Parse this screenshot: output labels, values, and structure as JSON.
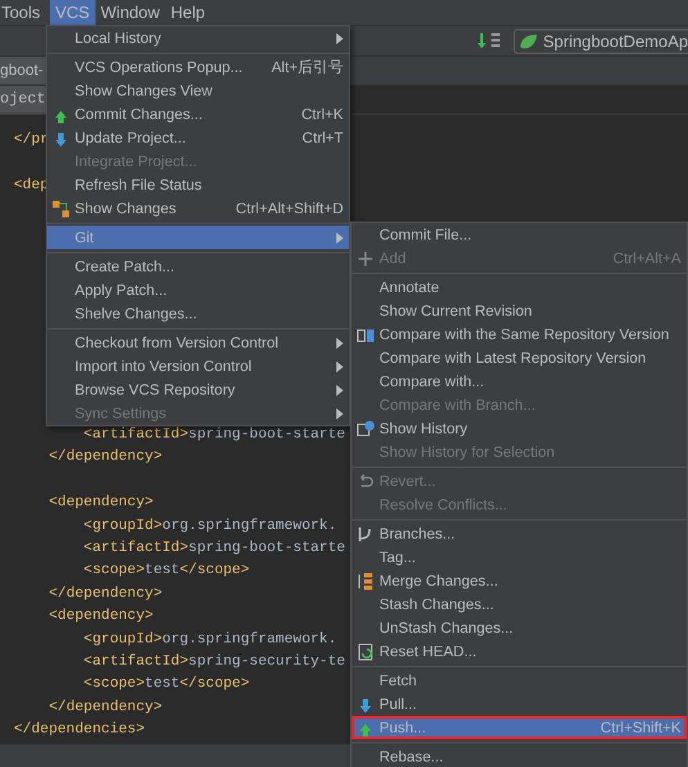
{
  "menu_bar": [
    {
      "label": "Tools",
      "selected": false
    },
    {
      "label": "VCS",
      "selected": true
    },
    {
      "label": "Window",
      "selected": false
    },
    {
      "label": "Help",
      "selected": false
    }
  ],
  "toolbar": {
    "run_config": "SpringbootDemoAp"
  },
  "editor_tab": {
    "label": "gboot-"
  },
  "tool_window": {
    "label": "oject"
  },
  "editor": {
    "lines": [
      {
        "kind": "code",
        "text": "</pr"
      },
      {
        "kind": "blank"
      },
      {
        "kind": "code",
        "text": "<dep"
      },
      {
        "kind": "blank"
      },
      {
        "kind": "blank"
      },
      {
        "kind": "blank"
      },
      {
        "kind": "blank"
      },
      {
        "kind": "blank"
      },
      {
        "kind": "blank"
      },
      {
        "kind": "blank"
      },
      {
        "kind": "blank"
      },
      {
        "kind": "blank"
      },
      {
        "kind": "blank"
      },
      {
        "kind": "code",
        "text": "        <artifactId>spring-boot-starte"
      },
      {
        "kind": "code",
        "text": "    </dependency>"
      },
      {
        "kind": "blank"
      },
      {
        "kind": "code",
        "text": "    <dependency>"
      },
      {
        "kind": "code",
        "text": "        <groupId>org.springframework."
      },
      {
        "kind": "code",
        "text": "        <artifactId>spring-boot-starte"
      },
      {
        "kind": "code",
        "text": "        <scope>test</scope>"
      },
      {
        "kind": "code",
        "text": "    </dependency>"
      },
      {
        "kind": "code",
        "text": "    <dependency>"
      },
      {
        "kind": "code",
        "text": "        <groupId>org.springframework."
      },
      {
        "kind": "code",
        "text": "        <artifactId>spring-security-te"
      },
      {
        "kind": "code",
        "text": "        <scope>test</scope>"
      },
      {
        "kind": "code",
        "text": "    </dependency>"
      },
      {
        "kind": "code",
        "text": "</dependencies>"
      }
    ]
  },
  "vcs_menu": {
    "items": [
      {
        "kind": "submenu",
        "label": "Local History",
        "disabled": false,
        "selected": false
      },
      {
        "kind": "separator"
      },
      {
        "kind": "item",
        "label": "VCS Operations Popup...",
        "shortcut": "Alt+后引号",
        "disabled": false,
        "selected": false
      },
      {
        "kind": "item",
        "label": "Show Changes View",
        "disabled": false,
        "selected": false
      },
      {
        "kind": "commit",
        "label": "Commit Changes...",
        "shortcut": "Ctrl+K",
        "disabled": false,
        "selected": false
      },
      {
        "kind": "update",
        "label": "Update Project...",
        "shortcut": "Ctrl+T",
        "disabled": false,
        "selected": false
      },
      {
        "kind": "item",
        "label": "Integrate Project...",
        "disabled": true,
        "selected": false
      },
      {
        "kind": "item",
        "label": "Refresh File Status",
        "disabled": false,
        "selected": false
      },
      {
        "kind": "changes",
        "label": "Show Changes",
        "shortcut": "Ctrl+Alt+Shift+D",
        "disabled": false,
        "selected": false
      },
      {
        "kind": "separator"
      },
      {
        "kind": "submenu",
        "label": "Git",
        "disabled": false,
        "selected": true
      },
      {
        "kind": "separator"
      },
      {
        "kind": "item",
        "label": "Create Patch...",
        "disabled": false,
        "selected": false
      },
      {
        "kind": "item",
        "label": "Apply Patch...",
        "disabled": false,
        "selected": false
      },
      {
        "kind": "item",
        "label": "Shelve Changes...",
        "disabled": false,
        "selected": false
      },
      {
        "kind": "separator"
      },
      {
        "kind": "submenu",
        "label": "Checkout from Version Control",
        "disabled": false,
        "selected": false
      },
      {
        "kind": "submenu",
        "label": "Import into Version Control",
        "disabled": false,
        "selected": false
      },
      {
        "kind": "submenu",
        "label": "Browse VCS Repository",
        "disabled": false,
        "selected": false
      },
      {
        "kind": "submenu",
        "label": "Sync Settings",
        "disabled": true,
        "selected": false
      }
    ]
  },
  "git_menu": {
    "items": [
      {
        "kind": "item",
        "label": "Commit File...",
        "disabled": false,
        "selected": false,
        "outlined": false
      },
      {
        "kind": "add",
        "label": "Add",
        "shortcut": "Ctrl+Alt+A",
        "disabled": true,
        "selected": false,
        "outlined": false
      },
      {
        "kind": "separator"
      },
      {
        "kind": "item",
        "label": "Annotate",
        "disabled": false,
        "selected": false,
        "outlined": false
      },
      {
        "kind": "item",
        "label": "Show Current Revision",
        "disabled": false,
        "selected": false,
        "outlined": false
      },
      {
        "kind": "compare",
        "label": "Compare with the Same Repository Version",
        "disabled": false,
        "selected": false,
        "outlined": false
      },
      {
        "kind": "item",
        "label": "Compare with Latest Repository Version",
        "disabled": false,
        "selected": false,
        "outlined": false
      },
      {
        "kind": "item",
        "label": "Compare with...",
        "disabled": false,
        "selected": false,
        "outlined": false
      },
      {
        "kind": "item",
        "label": "Compare with Branch...",
        "disabled": true,
        "selected": false,
        "outlined": false
      },
      {
        "kind": "history",
        "label": "Show History",
        "disabled": false,
        "selected": false,
        "outlined": false
      },
      {
        "kind": "item",
        "label": "Show History for Selection",
        "disabled": true,
        "selected": false,
        "outlined": false
      },
      {
        "kind": "separator"
      },
      {
        "kind": "revert",
        "label": "Revert...",
        "disabled": true,
        "selected": false,
        "outlined": false
      },
      {
        "kind": "item",
        "label": "Resolve Conflicts...",
        "disabled": true,
        "selected": false,
        "outlined": false
      },
      {
        "kind": "separator"
      },
      {
        "kind": "branches",
        "label": "Branches...",
        "disabled": false,
        "selected": false,
        "outlined": false
      },
      {
        "kind": "item",
        "label": "Tag...",
        "disabled": false,
        "selected": false,
        "outlined": false
      },
      {
        "kind": "merge",
        "label": "Merge Changes...",
        "disabled": false,
        "selected": false,
        "outlined": false
      },
      {
        "kind": "item",
        "label": "Stash Changes...",
        "disabled": false,
        "selected": false,
        "outlined": false
      },
      {
        "kind": "item",
        "label": "UnStash Changes...",
        "disabled": false,
        "selected": false,
        "outlined": false
      },
      {
        "kind": "reset",
        "label": "Reset HEAD...",
        "disabled": false,
        "selected": false,
        "outlined": false
      },
      {
        "kind": "separator"
      },
      {
        "kind": "item",
        "label": "Fetch",
        "disabled": false,
        "selected": false,
        "outlined": false
      },
      {
        "kind": "pull",
        "label": "Pull...",
        "disabled": false,
        "selected": false,
        "outlined": false
      },
      {
        "kind": "push",
        "label": "Push...",
        "shortcut": "Ctrl+Shift+K",
        "disabled": false,
        "selected": true,
        "outlined": true
      },
      {
        "kind": "separator"
      },
      {
        "kind": "item",
        "label": "Rebase...",
        "disabled": false,
        "selected": false,
        "outlined": false
      }
    ]
  }
}
